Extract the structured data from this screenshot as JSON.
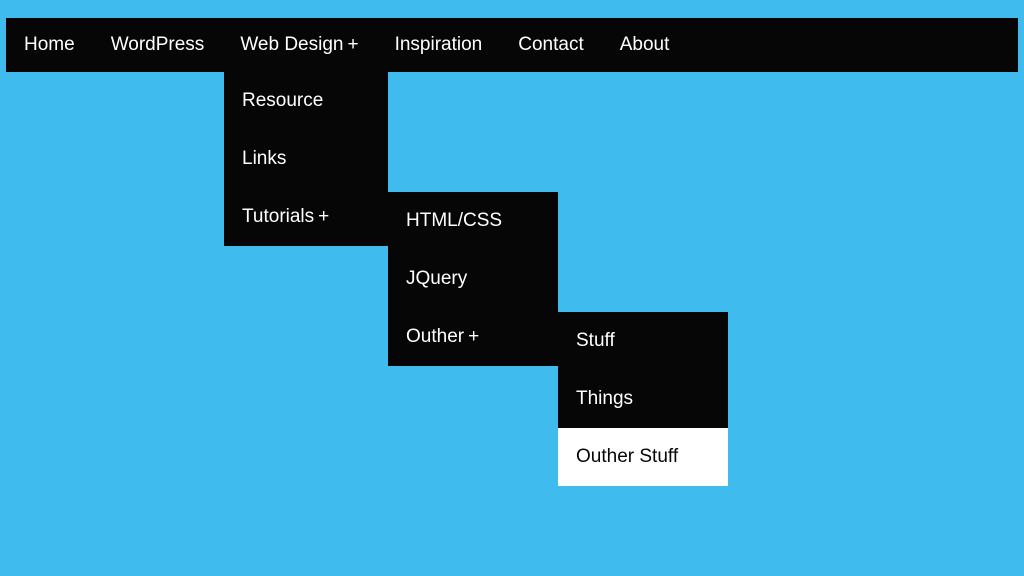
{
  "colors": {
    "background": "#3fbced",
    "menu_bg": "#060606",
    "menu_fg": "#ffffff",
    "hover_bg": "#ffffff",
    "hover_fg": "#060606"
  },
  "submenu_indicator": "+",
  "nav": {
    "items": [
      {
        "label": "Home",
        "has_children": false
      },
      {
        "label": "WordPress",
        "has_children": false
      },
      {
        "label": "Web Design",
        "has_children": true
      },
      {
        "label": "Inspiration",
        "has_children": false
      },
      {
        "label": "Contact",
        "has_children": false
      },
      {
        "label": "About",
        "has_children": false
      }
    ]
  },
  "dropdowns": {
    "web_design": {
      "items": [
        {
          "label": "Resource",
          "has_children": false
        },
        {
          "label": "Links",
          "has_children": false
        },
        {
          "label": "Tutorials",
          "has_children": true
        }
      ]
    },
    "tutorials": {
      "items": [
        {
          "label": "HTML/CSS",
          "has_children": false
        },
        {
          "label": "JQuery",
          "has_children": false
        },
        {
          "label": "Outher",
          "has_children": true
        }
      ]
    },
    "outher": {
      "items": [
        {
          "label": "Stuff",
          "has_children": false,
          "hover": false
        },
        {
          "label": "Things",
          "has_children": false,
          "hover": false
        },
        {
          "label": "Outher Stuff",
          "has_children": false,
          "hover": true
        }
      ]
    }
  }
}
